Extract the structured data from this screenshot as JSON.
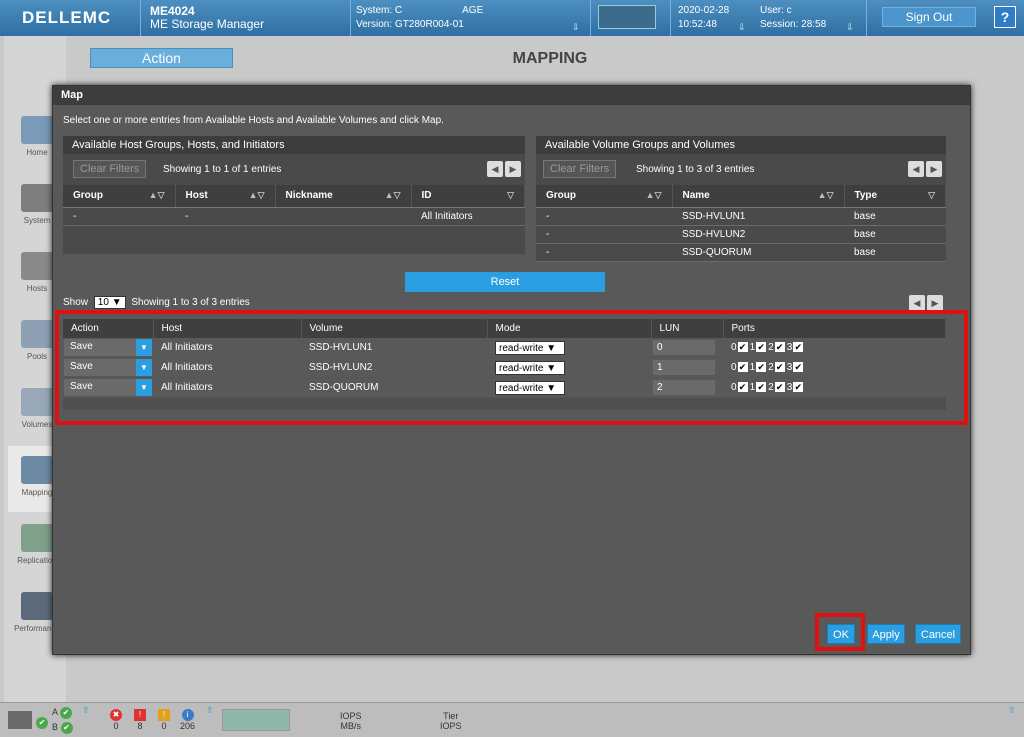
{
  "header": {
    "brand": "DELLEMC",
    "product": "ME4024",
    "product_sub": "ME Storage Manager",
    "system_label": "System: C",
    "system_suffix": "AGE",
    "version_label": "Version: GT280R004-01",
    "date": "2020-02-28",
    "time": "10:52:48",
    "user_label": "User: c",
    "session_label": "Session: 28:58",
    "sign_out": "Sign Out",
    "help": "?"
  },
  "nav": [
    {
      "label": "Home",
      "icon": "home-icon"
    },
    {
      "label": "System",
      "icon": "system-icon"
    },
    {
      "label": "Hosts",
      "icon": "hosts-icon"
    },
    {
      "label": "Pools",
      "icon": "pools-icon"
    },
    {
      "label": "Volumes",
      "icon": "volumes-icon"
    },
    {
      "label": "Mapping",
      "icon": "mapping-icon"
    },
    {
      "label": "Replication",
      "icon": "replication-icon"
    },
    {
      "label": "Performance",
      "icon": "performance-icon"
    }
  ],
  "page": {
    "action_label": "Action",
    "title": "MAPPING"
  },
  "modal": {
    "title": "Map",
    "instructions": "Select one or more entries from Available Hosts and Available Volumes and click Map.",
    "hosts_panel": {
      "title": "Available Host Groups, Hosts, and Initiators",
      "clear_filters": "Clear Filters",
      "showing": "Showing 1 to 1 of 1 entries",
      "columns": [
        "Group",
        "Host",
        "Nickname",
        "ID"
      ],
      "rows": [
        [
          "-",
          "-",
          "",
          "All Initiators"
        ]
      ]
    },
    "volumes_panel": {
      "title": "Available Volume Groups and Volumes",
      "clear_filters": "Clear Filters",
      "showing": "Showing 1 to 3 of 3 entries",
      "columns": [
        "Group",
        "Name",
        "Type"
      ],
      "rows": [
        [
          "-",
          "SSD-HVLUN1",
          "base"
        ],
        [
          "-",
          "SSD-HVLUN2",
          "base"
        ],
        [
          "-",
          "SSD-QUORUM",
          "base"
        ]
      ]
    },
    "reset": "Reset",
    "show_label": "Show",
    "show_value": "10",
    "map_showing": "Showing 1 to 3 of 3 entries",
    "map_columns": [
      "Action",
      "Host",
      "Volume",
      "Mode",
      "LUN",
      "Ports"
    ],
    "map_rows": [
      {
        "action": "Save",
        "host": "All Initiators",
        "volume": "SSD-HVLUN1",
        "mode": "read-write",
        "lun": "0"
      },
      {
        "action": "Save",
        "host": "All Initiators",
        "volume": "SSD-HVLUN2",
        "mode": "read-write",
        "lun": "1"
      },
      {
        "action": "Save",
        "host": "All Initiators",
        "volume": "SSD-QUORUM",
        "mode": "read-write",
        "lun": "2"
      }
    ],
    "ports": [
      "0",
      "1",
      "2",
      "3"
    ],
    "ok": "OK",
    "apply": "Apply",
    "cancel": "Cancel"
  },
  "footer": {
    "ctrl_a": "A",
    "ctrl_b": "B",
    "counts": [
      "0",
      "8",
      "0",
      "206"
    ],
    "iops": "IOPS",
    "mbs": "MB/s",
    "tier": "Tier",
    "tier_iops": "IOPS"
  }
}
